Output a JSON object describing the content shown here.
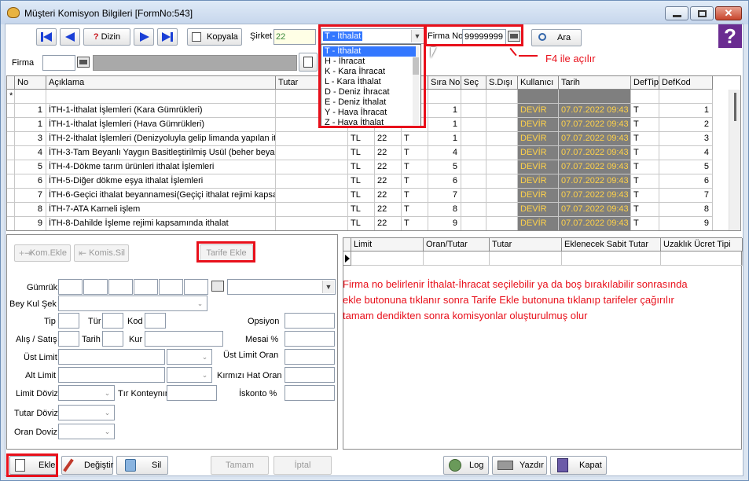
{
  "window": {
    "title": "Müşteri Komisyon Bilgileri [FormNo:543]"
  },
  "toolbar": {
    "dizin_label": "Dizin",
    "dizin_prefix": "?",
    "kopyala_label": "Kopyala",
    "sirket_label": "Şirket",
    "sirket_value": "22",
    "type_selected": "T - İthalat",
    "firma_no_label": "Firma No",
    "firma_no_value": "99999999",
    "ara_label": "Ara",
    "help_glyph": "?"
  },
  "firma_row": {
    "label": "Firma"
  },
  "annotations": {
    "f4": "F4 ile açılır",
    "note_line1": "Firma no belirlenir İthalat-İhracat seçilebilir ya da boş bırakılabilir sonrasında",
    "note_line2": "ekle butonuna tıklanır sonra Tarife Ekle butonuna tıklanıp tarifeler çağırılır",
    "note_line3": "tamam dendikten sonra komisyonlar oluşturulmuş olur"
  },
  "dropdown_items": [
    "T - İthalat",
    "H - İhracat",
    "K - Kara İhracat",
    "L - Kara İthalat",
    "D - Deniz İhracat",
    "E - Deniz İthalat",
    "Y - Hava İhracat",
    "Z - Hava İthalat"
  ],
  "grid": {
    "columns": [
      "No",
      "Açıklama",
      "Tutar",
      "Sıra No",
      "Seç",
      "S.Dışı",
      "Kullanıcı",
      "Tarih",
      "DefTip",
      "DefKod"
    ],
    "new_row_marker": "*",
    "rows": [
      {
        "no": "1",
        "aciklama": "İTH-1-İthalat İşlemleri  (Kara Gümrükleri)",
        "cur": "",
        "sirket": "",
        "flag": "",
        "sira": "1",
        "kullanici": "DEVİR",
        "tarih": "07.07.2022 09:43",
        "deftip": "T",
        "defkod": "1"
      },
      {
        "no": "1",
        "aciklama": "İTH-1-İthalat İşlemleri  (Hava Gümrükleri)",
        "cur": "",
        "sirket": "",
        "flag": "",
        "sira": "1",
        "kullanici": "DEVİR",
        "tarih": "07.07.2022 09:43",
        "deftip": "T",
        "defkod": "2"
      },
      {
        "no": "3",
        "aciklama": "İTH-2-İthalat İşlemleri (Denizyoluyla gelip limanda yapılan ithal",
        "cur": "TL",
        "sirket": "22",
        "flag": "T",
        "sira": "1",
        "kullanici": "DEVİR",
        "tarih": "07.07.2022 09:43",
        "deftip": "T",
        "defkod": "3"
      },
      {
        "no": "4",
        "aciklama": "İTH-3-Tam Beyanlı Yaygın Basitleştirilmiş Usül (beher beyanna",
        "cur": "TL",
        "sirket": "22",
        "flag": "T",
        "sira": "4",
        "kullanici": "DEVİR",
        "tarih": "07.07.2022 09:43",
        "deftip": "T",
        "defkod": "4"
      },
      {
        "no": "5",
        "aciklama": "İTH-4-Dökme tarım ürünleri ithalat İşlemleri",
        "cur": "TL",
        "sirket": "22",
        "flag": "T",
        "sira": "5",
        "kullanici": "DEVİR",
        "tarih": "07.07.2022 09:43",
        "deftip": "T",
        "defkod": "5"
      },
      {
        "no": "6",
        "aciklama": "İTH-5-Diğer dökme eşya ithalat İşlemleri",
        "cur": "TL",
        "sirket": "22",
        "flag": "T",
        "sira": "6",
        "kullanici": "DEVİR",
        "tarih": "07.07.2022 09:43",
        "deftip": "T",
        "defkod": "6"
      },
      {
        "no": "7",
        "aciklama": "İTH-6-Geçici ithalat beyannamesi(Geçiçi ithalat rejimi kapsam",
        "cur": "TL",
        "sirket": "22",
        "flag": "T",
        "sira": "7",
        "kullanici": "DEVİR",
        "tarih": "07.07.2022 09:43",
        "deftip": "T",
        "defkod": "7"
      },
      {
        "no": "8",
        "aciklama": "İTH-7-ATA Karneli işlem",
        "cur": "TL",
        "sirket": "22",
        "flag": "T",
        "sira": "8",
        "kullanici": "DEVİR",
        "tarih": "07.07.2022 09:43",
        "deftip": "T",
        "defkod": "8"
      },
      {
        "no": "9",
        "aciklama": "İTH-8-Dahilde İşleme rejimi kapsamında ithalat",
        "cur": "TL",
        "sirket": "22",
        "flag": "T",
        "sira": "9",
        "kullanici": "DEVİR",
        "tarih": "07.07.2022 09:43",
        "deftip": "T",
        "defkod": "9"
      }
    ]
  },
  "left_panel": {
    "kom_ekle": "Kom.Ekle",
    "komis_sil": "Komis.Sil",
    "tarife_ekle": "Tarife Ekle",
    "gumruk": "Gümrük",
    "bey_kul_sek": "Bey Kul Şek",
    "tip": "Tip",
    "tur": "Tür",
    "kod": "Kod",
    "opsiyon": "Opsiyon",
    "alis_satis": "Alış / Satış",
    "tarih": "Tarih",
    "kur": "Kur",
    "mesai": "Mesai %",
    "ust_limit": "Üst Limit",
    "ust_limit_oran": "Üst Limit Oran",
    "alt_limit": "Alt Limit",
    "kirmizi_hat_oran": "Kırmızı Hat Oran",
    "limit_doviz": "Limit Döviz",
    "tir_konteynir": "Tır Konteynır",
    "iskonto": "İskonto %",
    "tutar_doviz": "Tutar Döviz",
    "oran_doviz": "Oran Doviz"
  },
  "bottom_grid": {
    "columns": [
      "Limit",
      "Oran/Tutar",
      "Tutar",
      "Eklenecek Sabit Tutar",
      "Uzaklık Ücret Tipi"
    ]
  },
  "status_bar": {
    "ekle": "Ekle",
    "degistir": "Değiştir",
    "sil": "Sil",
    "tamam": "Tamam",
    "iptal": "İptal",
    "log": "Log",
    "yazdir": "Yazdır",
    "kapat": "Kapat"
  },
  "colors": {
    "accent_red": "#e8101b",
    "devir_bg": "#7f7f7f",
    "devir_text": "#ffd24a",
    "selected_blue": "#3377ff",
    "nav_blue": "#1a3fd6"
  }
}
